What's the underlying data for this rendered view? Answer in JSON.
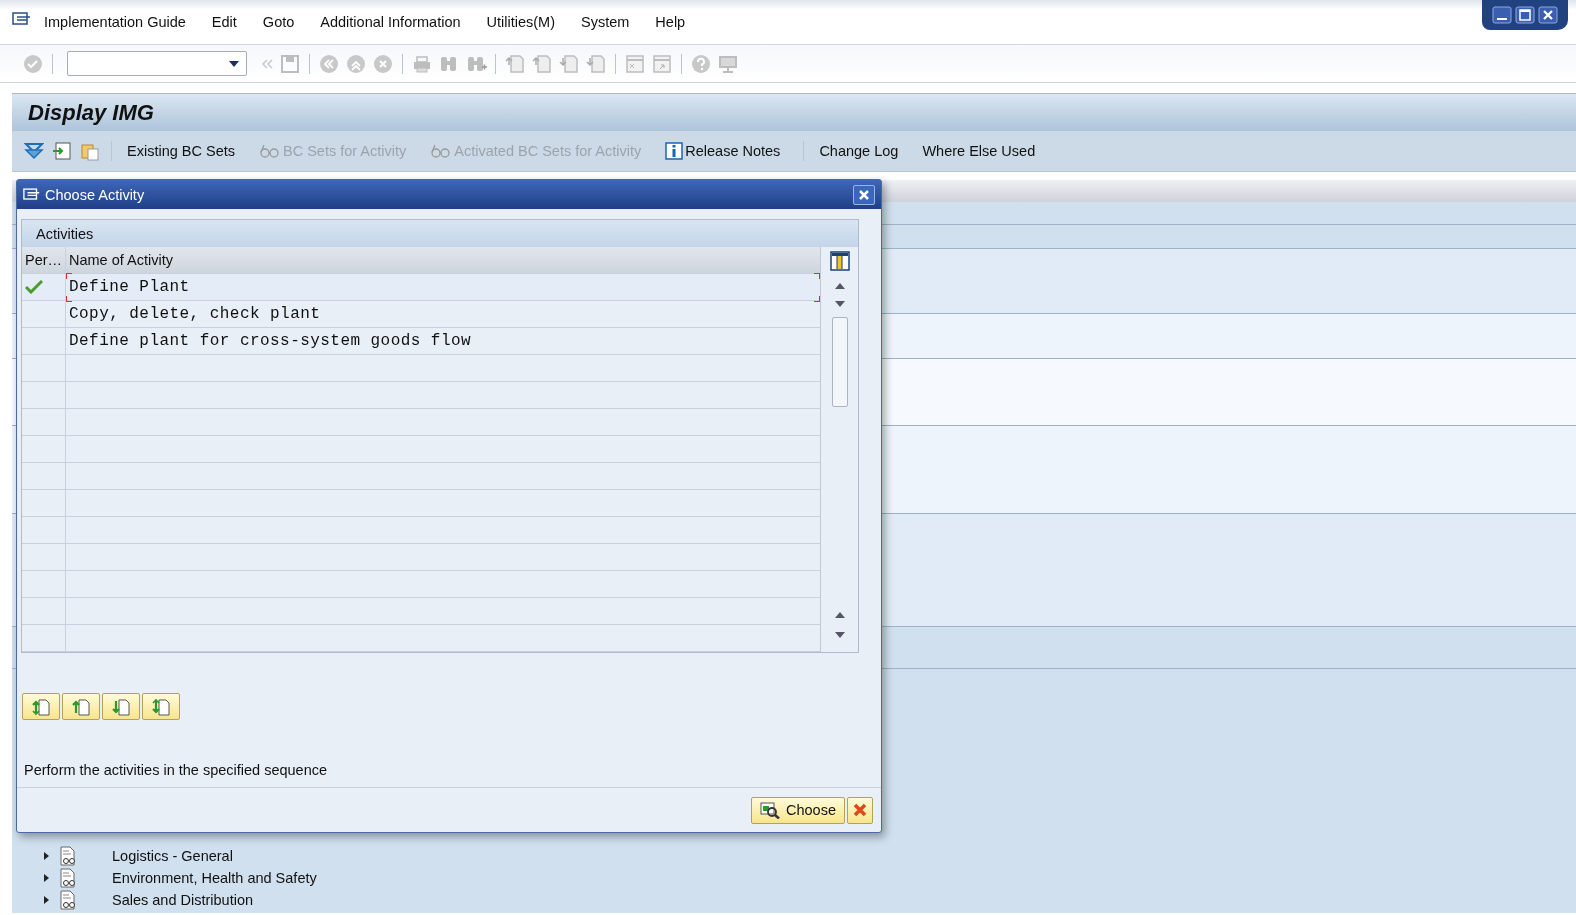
{
  "menu_bar": [
    {
      "label": "Implementation Guide"
    },
    {
      "label": "Edit"
    },
    {
      "label": "Goto"
    },
    {
      "label": "Additional Information"
    },
    {
      "label": "Utilities(M)"
    },
    {
      "label": "System"
    },
    {
      "label": "Help"
    }
  ],
  "title": "Display IMG",
  "app_toolbar": [
    {
      "kind": "plain",
      "label": "Existing BC Sets",
      "disabled": false
    },
    {
      "kind": "bcset",
      "label": "BC Sets for Activity",
      "disabled": true
    },
    {
      "kind": "bcset",
      "label": "Activated BC Sets for Activity",
      "disabled": true
    },
    {
      "kind": "info",
      "label": "Release Notes",
      "disabled": false
    },
    {
      "kind": "plain",
      "label": "Change Log",
      "disabled": false
    },
    {
      "kind": "plain",
      "label": "Where Else Used",
      "disabled": false
    }
  ],
  "dialog": {
    "title": "Choose Activity",
    "group_title": "Activities",
    "columns": [
      "Per…",
      "Name of Activity"
    ],
    "rows": [
      {
        "performed": true,
        "name": "Define Plant",
        "selected": true
      },
      {
        "performed": false,
        "name": "Copy, delete, check plant",
        "selected": false
      },
      {
        "performed": false,
        "name": "Define plant for cross-system goods flow",
        "selected": false
      }
    ],
    "note": "Perform the activities in the specified sequence",
    "buttons": [
      {
        "kind": "choose",
        "label": "Choose"
      },
      {
        "kind": "cancel"
      }
    ]
  },
  "tree": [
    {
      "label": "Logistics - General",
      "expanded": false
    },
    {
      "label": "Environment, Health and Safety",
      "expanded": false
    },
    {
      "label": "Sales and Distribution",
      "expanded": false
    }
  ]
}
